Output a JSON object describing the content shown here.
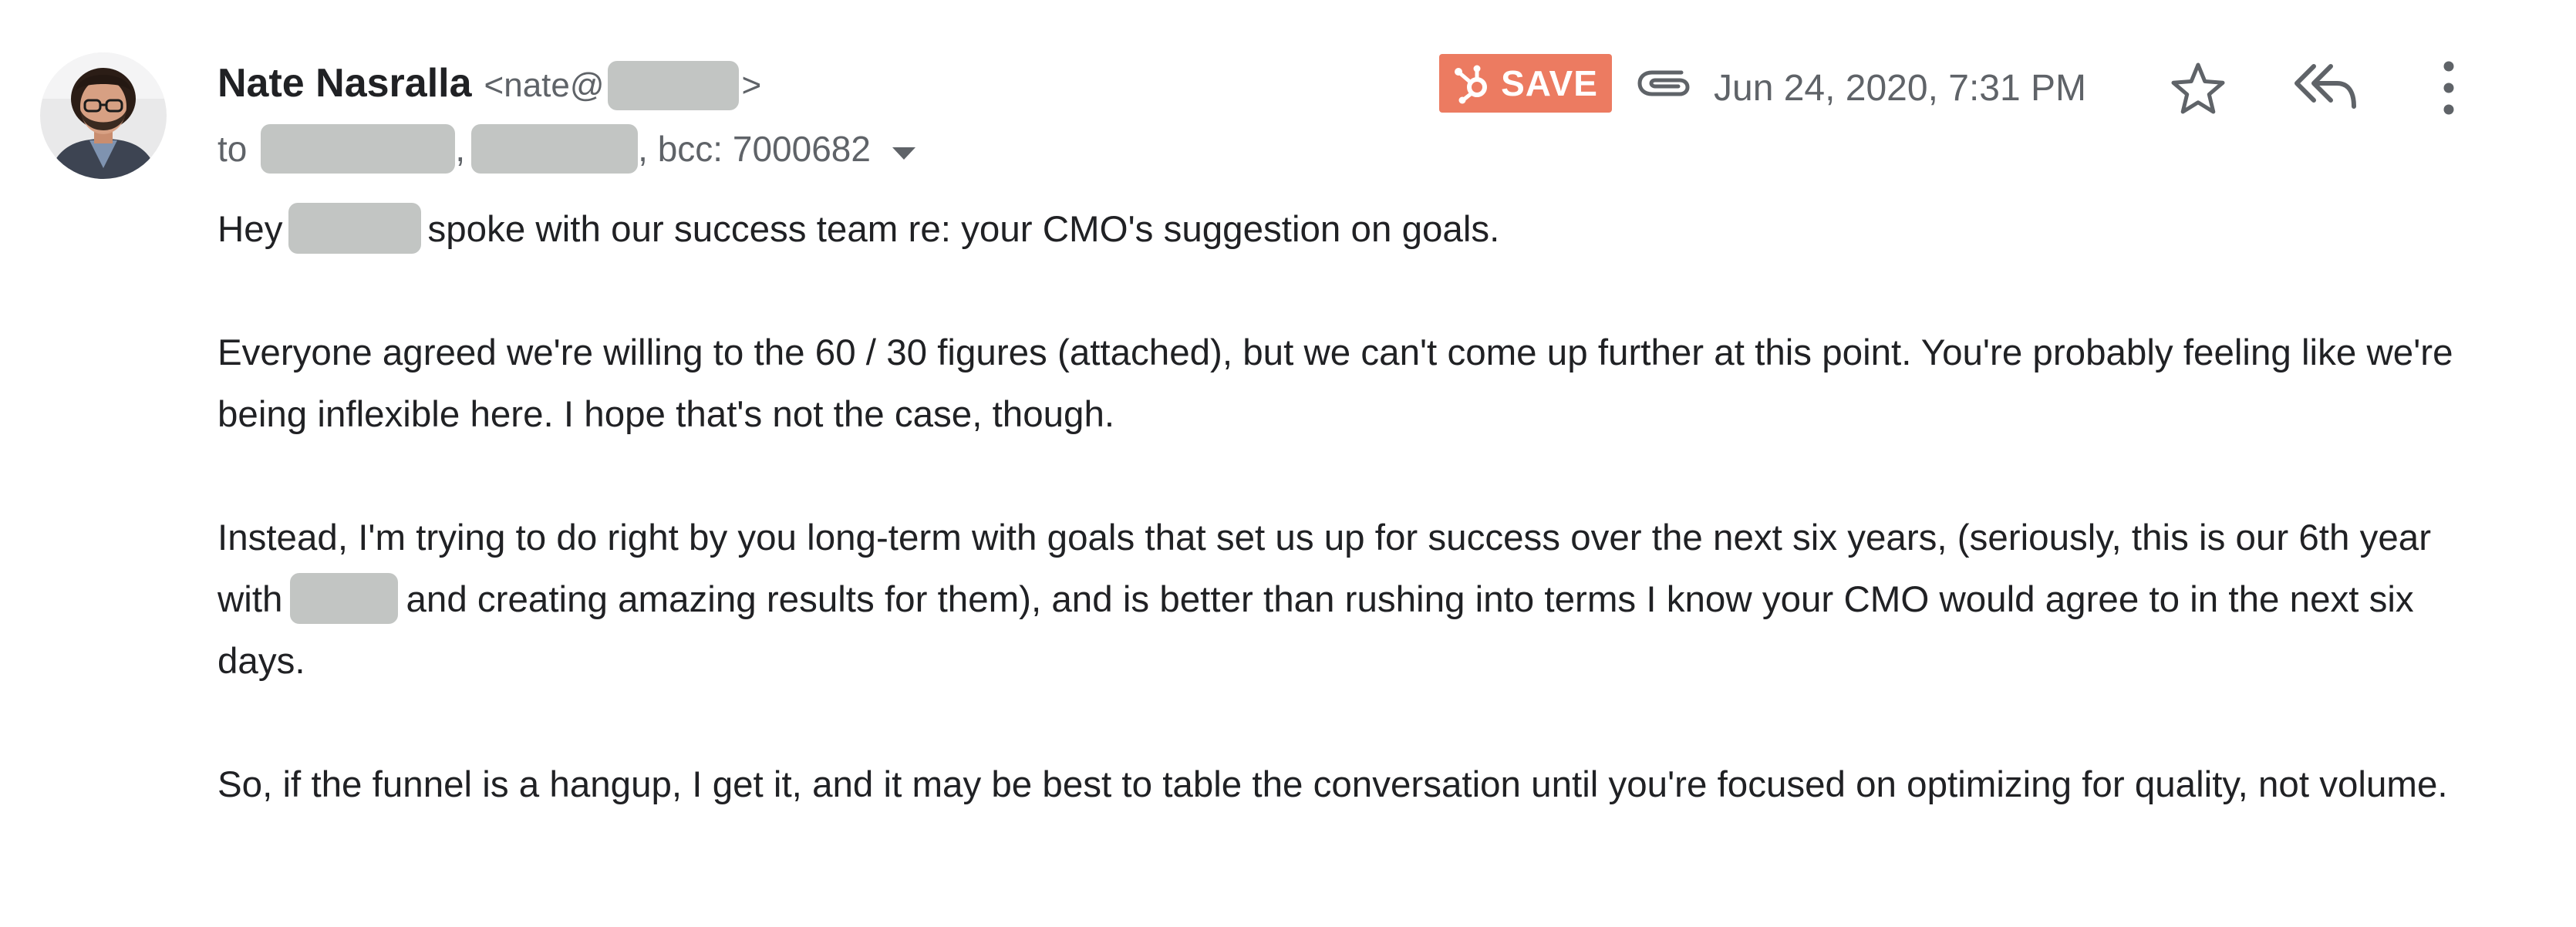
{
  "sender": {
    "name": "Nate Nasralla",
    "email_prefix": "<nate@",
    "email_suffix": ">"
  },
  "recipients": {
    "to_label": "to",
    "separator": ",",
    "bcc": ", bcc: 7000682"
  },
  "toolbar": {
    "save_label": "SAVE",
    "date": "Jun 24, 2020, 7:31 PM"
  },
  "colors": {
    "save_button": "#ec7b61",
    "redaction": "#c2c5c3"
  },
  "icons": {
    "attachment": "paperclip-icon",
    "star": "star-icon",
    "reply_all": "reply-all-icon",
    "more": "more-vertical-icon",
    "dropdown": "caret-down-icon",
    "brand": "hubspot-sprocket-icon"
  },
  "body": {
    "p1_before": "Hey",
    "p1_after": "spoke with our success team re: your CMO's suggestion on goals.",
    "p2": "Everyone agreed we're willing to the 60 / 30 figures (attached), but we can't come up further at this point. You're probably feeling like we're being inflexible here. I hope that's not the case, though.",
    "p3_before": "Instead, I'm trying to do right by you long-term with goals that set us up for success over the next six years, (seriously, this is our 6th year with",
    "p3_after": "and creating amazing results for them), and is better than rushing into terms I know your CMO would agree to in the next six days.",
    "p4": "So, if the funnel is a hangup, I get it, and it may be best to table the conversation until you're focused on optimizing for quality, not volume."
  }
}
